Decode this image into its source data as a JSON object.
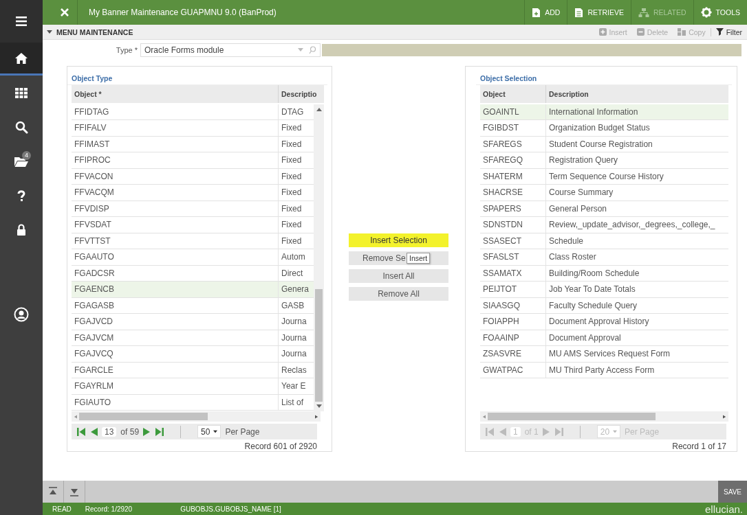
{
  "sidebar": {
    "items": [
      {
        "kind": "menu",
        "selected": false
      },
      {
        "kind": "home",
        "selected": true
      },
      {
        "kind": "grid",
        "selected": false
      },
      {
        "kind": "search",
        "selected": false
      },
      {
        "kind": "folder",
        "selected": false,
        "badge": "4"
      },
      {
        "kind": "help",
        "selected": false
      },
      {
        "kind": "lock",
        "selected": false
      },
      {
        "kind": "user",
        "selected": false
      }
    ]
  },
  "header": {
    "title": "My Banner Maintenance GUAPMNU 9.0 (BanProd)",
    "actions": [
      {
        "kind": "add",
        "label": "ADD",
        "disabled": false
      },
      {
        "kind": "retrieve",
        "label": "RETRIEVE",
        "disabled": false
      },
      {
        "kind": "related",
        "label": "RELATED",
        "disabled": true
      },
      {
        "kind": "tools",
        "label": "TOOLS",
        "disabled": false
      }
    ]
  },
  "section": {
    "title": "MENU MAINTENANCE",
    "expanded": true,
    "actions": [
      {
        "kind": "insert",
        "label": "Insert",
        "disabled": true
      },
      {
        "kind": "delete",
        "label": "Delete",
        "disabled": true
      },
      {
        "kind": "copy",
        "label": "Copy",
        "disabled": true
      },
      {
        "kind": "filter",
        "label": "Filter",
        "disabled": false
      }
    ]
  },
  "type_field": {
    "label": "Type *",
    "value": "Oracle Forms module"
  },
  "panels": [
    {
      "title": "Object Type",
      "columns": [
        "Object *",
        "Descriptio"
      ],
      "rows": [
        {
          "object": "FFIDTAG",
          "description": "DTAG",
          "selected": false
        },
        {
          "object": "FFIFALV",
          "description": "Fixed",
          "selected": false
        },
        {
          "object": "FFIMAST",
          "description": "Fixed",
          "selected": false
        },
        {
          "object": "FFIPROC",
          "description": "Fixed",
          "selected": false
        },
        {
          "object": "FFVACON",
          "description": "Fixed",
          "selected": false
        },
        {
          "object": "FFVACQM",
          "description": "Fixed",
          "selected": false
        },
        {
          "object": "FFVDISP",
          "description": "Fixed",
          "selected": false
        },
        {
          "object": "FFVSDAT",
          "description": "Fixed",
          "selected": false
        },
        {
          "object": "FFVTTST",
          "description": "Fixed",
          "selected": false
        },
        {
          "object": "FGAAUTO",
          "description": "Autom",
          "selected": false
        },
        {
          "object": "FGADCSR",
          "description": "Direct",
          "selected": false
        },
        {
          "object": "FGAENCB",
          "description": "Genera",
          "selected": true
        },
        {
          "object": "FGAGASB",
          "description": "GASB",
          "selected": false
        },
        {
          "object": "FGAJVCD",
          "description": "Journa",
          "selected": false
        },
        {
          "object": "FGAJVCM",
          "description": "Journa",
          "selected": false
        },
        {
          "object": "FGAJVCQ",
          "description": "Journa",
          "selected": false
        },
        {
          "object": "FGARCLE",
          "description": "Reclas",
          "selected": false
        },
        {
          "object": "FGAYRLM",
          "description": "Year E",
          "selected": false
        },
        {
          "object": "FGIAUTO",
          "description": "List of",
          "selected": false
        }
      ],
      "pager": {
        "disabled": false,
        "page": "13",
        "of": "of 59",
        "per_page": "50",
        "per_page_label": "Per Page"
      },
      "record": "Record 601 of 2920"
    },
    {
      "title": "Object Selection",
      "columns": [
        "Object",
        "Description"
      ],
      "rows": [
        {
          "object": "GOAINTL",
          "description": "International Information",
          "selected": true
        },
        {
          "object": "FGIBDST",
          "description": "Organization Budget Status",
          "selected": false
        },
        {
          "object": "SFAREGS",
          "description": "Student Course Registration",
          "selected": false
        },
        {
          "object": "SFAREGQ",
          "description": "Registration Query",
          "selected": false
        },
        {
          "object": "SHATERM",
          "description": "Term Sequence Course History",
          "selected": false
        },
        {
          "object": "SHACRSE",
          "description": "Course Summary",
          "selected": false
        },
        {
          "object": "SPAPERS",
          "description": "General Person",
          "selected": false
        },
        {
          "object": "SDNSTDN",
          "description": "Review,_update_advisor,_degrees,_college,_",
          "selected": false
        },
        {
          "object": "SSASECT",
          "description": "Schedule",
          "selected": false
        },
        {
          "object": "SFASLST",
          "description": "Class Roster",
          "selected": false
        },
        {
          "object": "SSAMATX",
          "description": "Building/Room Schedule",
          "selected": false
        },
        {
          "object": "PEIJTOT",
          "description": "Job Year To Date Totals",
          "selected": false
        },
        {
          "object": "SIAASGQ",
          "description": "Faculty Schedule Query",
          "selected": false
        },
        {
          "object": "FOIAPPH",
          "description": "Document Approval History",
          "selected": false
        },
        {
          "object": "FOAAINP",
          "description": "Document Approval",
          "selected": false
        },
        {
          "object": "ZSASVRE",
          "description": "MU AMS Services Request Form",
          "selected": false
        },
        {
          "object": "GWATPAC",
          "description": "MU Third Party Access Form",
          "selected": false
        }
      ],
      "pager": {
        "disabled": true,
        "page": "1",
        "of": "of 1",
        "per_page": "20",
        "per_page_label": "Per Page"
      },
      "record": "Record 1 of 17"
    }
  ],
  "transfer_buttons": [
    {
      "label": "Insert Selection",
      "highlighted": true
    },
    {
      "label": "Remove Se",
      "highlighted": false
    },
    {
      "label": "Insert All",
      "highlighted": false
    },
    {
      "label": "Remove All",
      "highlighted": false
    }
  ],
  "tooltip": "Insert",
  "toolbar": {
    "save": "SAVE"
  },
  "status_bar": {
    "mode": "READ",
    "record": "Record: 1/2920",
    "field": "GUBOBJS.GUBOBJS_NAME [1]",
    "brand": "ellucian."
  }
}
